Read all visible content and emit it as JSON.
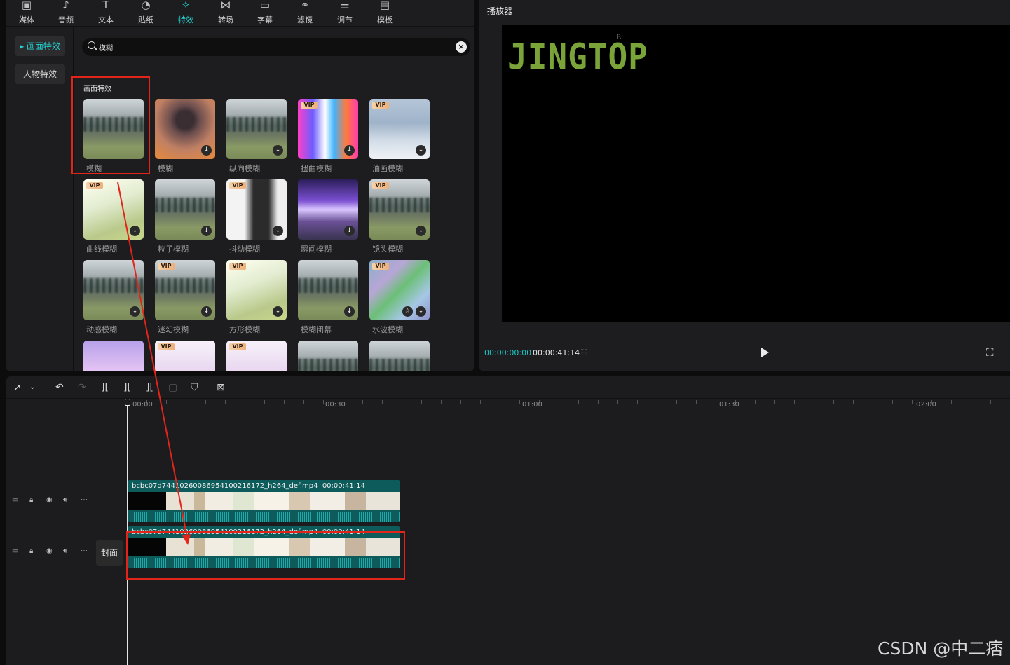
{
  "toolbar": {
    "tabs": [
      {
        "label": "媒体",
        "icon": "media-icon"
      },
      {
        "label": "音频",
        "icon": "audio-icon"
      },
      {
        "label": "文本",
        "icon": "text-icon"
      },
      {
        "label": "贴纸",
        "icon": "sticker-icon"
      },
      {
        "label": "特效",
        "icon": "effects-icon",
        "active": true
      },
      {
        "label": "转场",
        "icon": "transition-icon"
      },
      {
        "label": "字幕",
        "icon": "subtitle-icon"
      },
      {
        "label": "滤镜",
        "icon": "filter-icon"
      },
      {
        "label": "调节",
        "icon": "adjust-icon"
      },
      {
        "label": "模板",
        "icon": "template-icon"
      }
    ]
  },
  "sidebar": {
    "items": [
      {
        "label": "画面特效",
        "active": true
      },
      {
        "label": "人物特效",
        "active": false
      }
    ]
  },
  "search": {
    "value": "模糊"
  },
  "effects": {
    "section_title": "画面特效",
    "items": [
      {
        "label": "模糊",
        "vip": false
      },
      {
        "label": "模糊",
        "vip": false
      },
      {
        "label": "纵向模糊",
        "vip": false
      },
      {
        "label": "扭曲模糊",
        "vip": true
      },
      {
        "label": "油画模糊",
        "vip": true
      },
      {
        "label": "曲线模糊",
        "vip": true
      },
      {
        "label": "粒子模糊",
        "vip": false
      },
      {
        "label": "抖动模糊",
        "vip": true
      },
      {
        "label": "瞬间模糊",
        "vip": false
      },
      {
        "label": "镜头模糊",
        "vip": true
      },
      {
        "label": "动感模糊",
        "vip": false
      },
      {
        "label": "迷幻模糊",
        "vip": true
      },
      {
        "label": "方形模糊",
        "vip": true
      },
      {
        "label": "模糊闭幕",
        "vip": false
      },
      {
        "label": "水波模糊",
        "vip": true
      }
    ],
    "vip_badge": "VIP"
  },
  "player": {
    "title": "播放器",
    "logo_text": "JINGTOP",
    "logo_mark": "R",
    "current_time": "00:00:00:00",
    "total_time": "00:00:41:14"
  },
  "timeline": {
    "ruler": [
      "00:00",
      "00:30",
      "01:00",
      "01:30",
      "02:00"
    ],
    "clips": [
      {
        "name": "bcbc07d74410260086954100216172_h264_def.mp4",
        "duration": "00:00:41:14"
      },
      {
        "name": "bcbc07d74410260086954100216172_h264_def.mp4",
        "duration": "00:00:41:14"
      }
    ],
    "cover_label": "封面"
  },
  "watermark": "CSDN @中二痞",
  "colors": {
    "accent": "#23d3d3",
    "annotation": "#e3241b",
    "logo": "#7aa339"
  }
}
